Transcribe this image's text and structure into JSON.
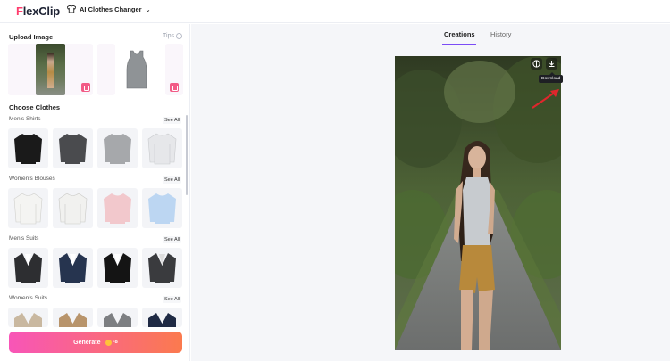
{
  "app": {
    "logo_text_rest": "lexClip",
    "logo_letter": "F"
  },
  "header": {
    "tool_name": "AI Clothes Changer"
  },
  "upload": {
    "title": "Upload Image",
    "tips": "Tips"
  },
  "choose": {
    "title": "Choose Clothes"
  },
  "categories": [
    {
      "name": "Men's Shirts",
      "see_all": "See All"
    },
    {
      "name": "Women's Blouses",
      "see_all": "See All"
    },
    {
      "name": "Men's Suits",
      "see_all": "See All"
    },
    {
      "name": "Women's Suits",
      "see_all": "See All"
    }
  ],
  "generate": {
    "label": "Generate",
    "cost": "-8"
  },
  "tabs": [
    {
      "label": "Creations"
    },
    {
      "label": "History"
    }
  ],
  "result": {
    "tooltip": "Download"
  },
  "colors": {
    "accent": "#7b4cf6",
    "brand_pink": "#ff3d6e",
    "generate_start": "#f855b8",
    "generate_end": "#fb7a4e",
    "arrow": "#e0262c"
  }
}
